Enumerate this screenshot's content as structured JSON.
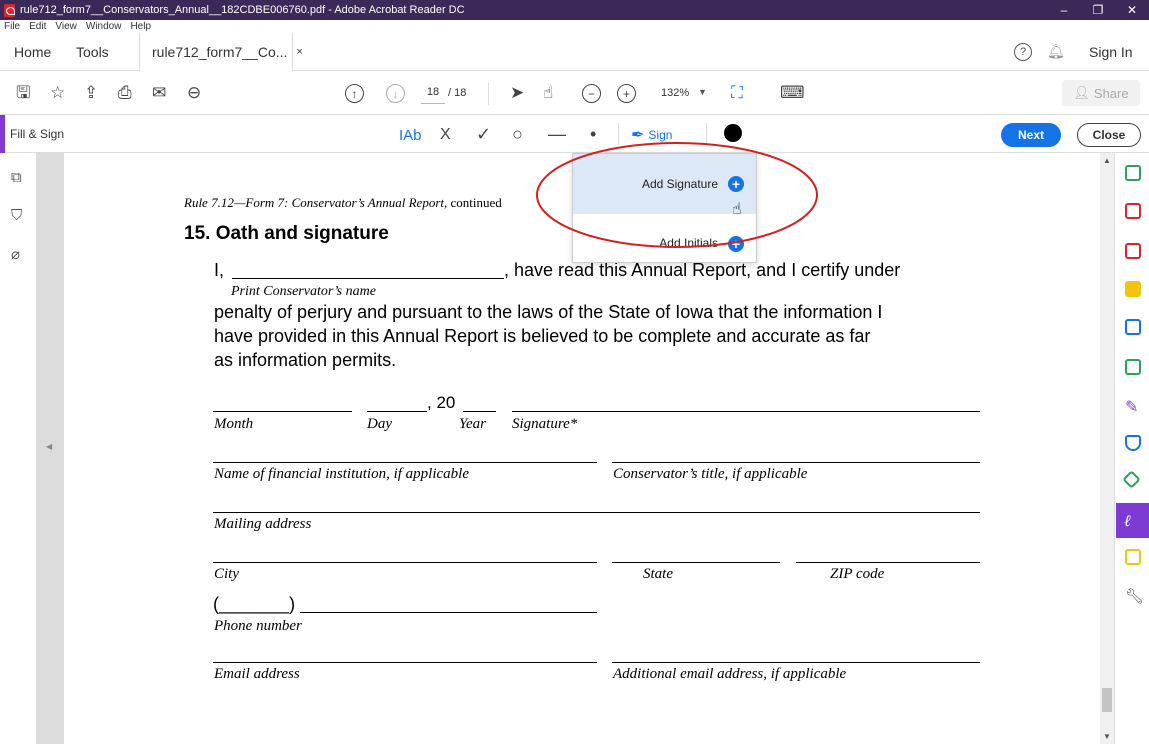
{
  "window": {
    "title": "rule712_form7__Conservators_Annual__182CDBE006760.pdf - Adobe Acrobat Reader DC",
    "minimize": "–",
    "restore": "❐",
    "close": "✕"
  },
  "menu": [
    "File",
    "Edit",
    "View",
    "Window",
    "Help"
  ],
  "tabs": {
    "home": "Home",
    "tools": "Tools",
    "doc": "rule712_form7__Co...",
    "doc_close": "×",
    "help": "?",
    "signin": "Sign In"
  },
  "toolbar": {
    "page_current": "18",
    "page_total": "/ 18",
    "zoom": "132%",
    "share": "Share"
  },
  "fillsign": {
    "title": "Fill & Sign",
    "text_tool": "IAb",
    "cross": "X",
    "check": "✓",
    "circle": "○",
    "line": "—",
    "dot": "•",
    "sign": "Sign",
    "next": "Next",
    "close": "Close",
    "color_dot": "#000000"
  },
  "signature_menu": {
    "add_signature": "Add Signature",
    "add_initials": "Add Initials"
  },
  "document": {
    "header": "Rule 7.12—Form 7: Conservator’s Annual Report,",
    "header_cont": "continued",
    "section_title": "15. Oath and signature",
    "i_prefix": "I,",
    "line1_suffix": ", have read this Annual Report, and I certify under",
    "print_name_label": "Print Conservator’s name",
    "line2": "penalty of perjury and pursuant to the laws of the State of Iowa that the information I",
    "line3": "have provided in this Annual Report is believed to be complete and accurate as far",
    "line4": "as information permits.",
    "year_prefix": ", 20",
    "labels": {
      "month": "Month",
      "day": "Day",
      "year": "Year",
      "signature": "Signature*",
      "financial_institution": "Name of financial institution, if applicable",
      "conservator_title": "Conservator’s title, if applicable",
      "mailing_address": "Mailing address",
      "city": "City",
      "state": "State",
      "zip": "ZIP code",
      "phone": "Phone number",
      "email": "Email address",
      "additional_email": "Additional email address, if applicable"
    },
    "phone_parens": "(_______)"
  },
  "colors": {
    "titlebar": "#3b2a58",
    "accent": "#7e3bd4",
    "blue": "#1473e6",
    "annotation": "#d42020"
  }
}
